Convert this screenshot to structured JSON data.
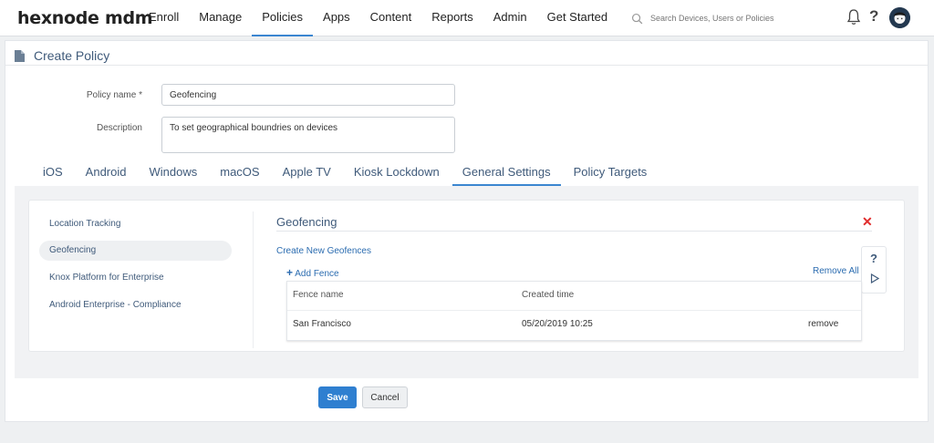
{
  "app": {
    "logo": "hexnode mdm",
    "colors": {
      "accent": "#3b86d0",
      "primary_button": "#2f7fd0",
      "danger": "#e02b2b",
      "heading": "#3f5a7a"
    }
  },
  "nav": {
    "items": [
      "Enroll",
      "Manage",
      "Policies",
      "Apps",
      "Content",
      "Reports",
      "Admin",
      "Get Started"
    ],
    "active": "Policies"
  },
  "search": {
    "placeholder": "Search Devices, Users or Policies",
    "icon": "search-icon"
  },
  "header_icons": [
    "bell-icon",
    "help-icon",
    "avatar"
  ],
  "page": {
    "title": "Create Policy",
    "icon": "document-icon"
  },
  "form": {
    "policy_name_label": "Policy name *",
    "policy_name_value": "Geofencing",
    "description_label": "Description",
    "description_value": "To set geographical boundries on devices"
  },
  "tabs": {
    "items": [
      "iOS",
      "Android",
      "Windows",
      "macOS",
      "Apple TV",
      "Kiosk Lockdown",
      "General Settings",
      "Policy Targets"
    ],
    "active": "General Settings"
  },
  "sidebar": {
    "items": [
      "Location Tracking",
      "Geofencing",
      "Knox Platform for Enterprise",
      "Android Enterprise - Compliance"
    ],
    "active": "Geofencing"
  },
  "section": {
    "title": "Geofencing",
    "create_link": "Create New Geofences",
    "add_fence": "Add Fence",
    "remove_all": "Remove All",
    "tools": {
      "help": "?",
      "play": "play-icon"
    },
    "table": {
      "headers": [
        "Fence name",
        "Created time"
      ],
      "rows": [
        {
          "name": "San Francisco",
          "created": "05/20/2019 10:25",
          "action": "remove"
        }
      ]
    }
  },
  "actions": {
    "save": "Save",
    "cancel": "Cancel"
  }
}
